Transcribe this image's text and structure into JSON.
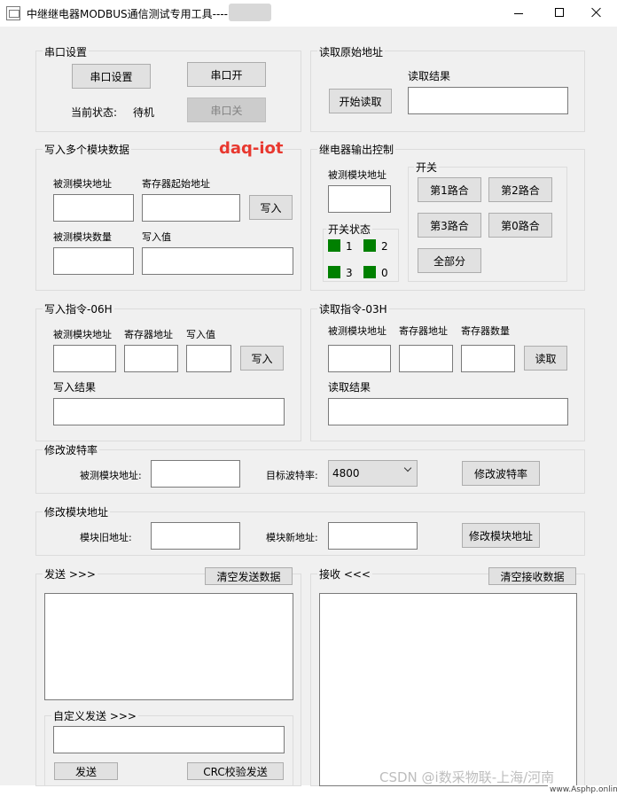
{
  "window": {
    "title": "中继继电器MODBUS通信测试专用工具----"
  },
  "serial": {
    "legend": "串口设置",
    "settings_button": "串口设置",
    "open_button": "串口开",
    "close_button": "串口关",
    "status_label": "当前状态:",
    "status_value": "待机"
  },
  "read_raw": {
    "legend": "读取原始地址",
    "result_label": "读取结果",
    "start_button": "开始读取",
    "result_value": ""
  },
  "write_multi": {
    "legend": "写入多个模块数据",
    "module_addr_label": "被测模块地址",
    "reg_start_label": "寄存器起始地址",
    "write_button": "写入",
    "module_count_label": "被测模块数量",
    "value_label": "写入值"
  },
  "watermark_red": "daq-iot",
  "relay": {
    "legend": "继电器输出控制",
    "module_addr_label": "被测模块地址",
    "switch_legend": "开关",
    "route1": "第1路合",
    "route2": "第2路合",
    "route3": "第3路合",
    "route0": "第0路合",
    "all": "全部分",
    "status_legend": "开关状态",
    "leds": [
      {
        "label": "1",
        "color": "#008000"
      },
      {
        "label": "2",
        "color": "#008000"
      },
      {
        "label": "3",
        "color": "#008000"
      },
      {
        "label": "0",
        "color": "#008000"
      }
    ]
  },
  "write06": {
    "legend": "写入指令-06H",
    "module_addr_label": "被测模块地址",
    "reg_addr_label": "寄存器地址",
    "value_label": "写入值",
    "write_button": "写入",
    "result_label": "写入结果"
  },
  "read03": {
    "legend": "读取指令-03H",
    "module_addr_label": "被测模块地址",
    "reg_addr_label": "寄存器地址",
    "reg_count_label": "寄存器数量",
    "read_button": "读取",
    "result_label": "读取结果"
  },
  "baud": {
    "legend": "修改波特率",
    "module_addr_label": "被测模块地址:",
    "target_label": "目标波特率:",
    "selected": "4800",
    "button": "修改波特率"
  },
  "addr": {
    "legend": "修改模块地址",
    "old_label": "模块旧地址:",
    "new_label": "模块新地址:",
    "button": "修改模块地址"
  },
  "send": {
    "legend": "发送 >>>",
    "clear_button": "清空发送数据",
    "custom_legend": "自定义发送 >>>",
    "send_button": "发送",
    "crc_button": "CRC校验发送"
  },
  "recv": {
    "legend": "接收 <<<",
    "clear_button": "清空接收数据"
  },
  "watermark": {
    "csdn": "CSDN @i数采物联-上海/河南",
    "site": "www.Asphp.online"
  }
}
